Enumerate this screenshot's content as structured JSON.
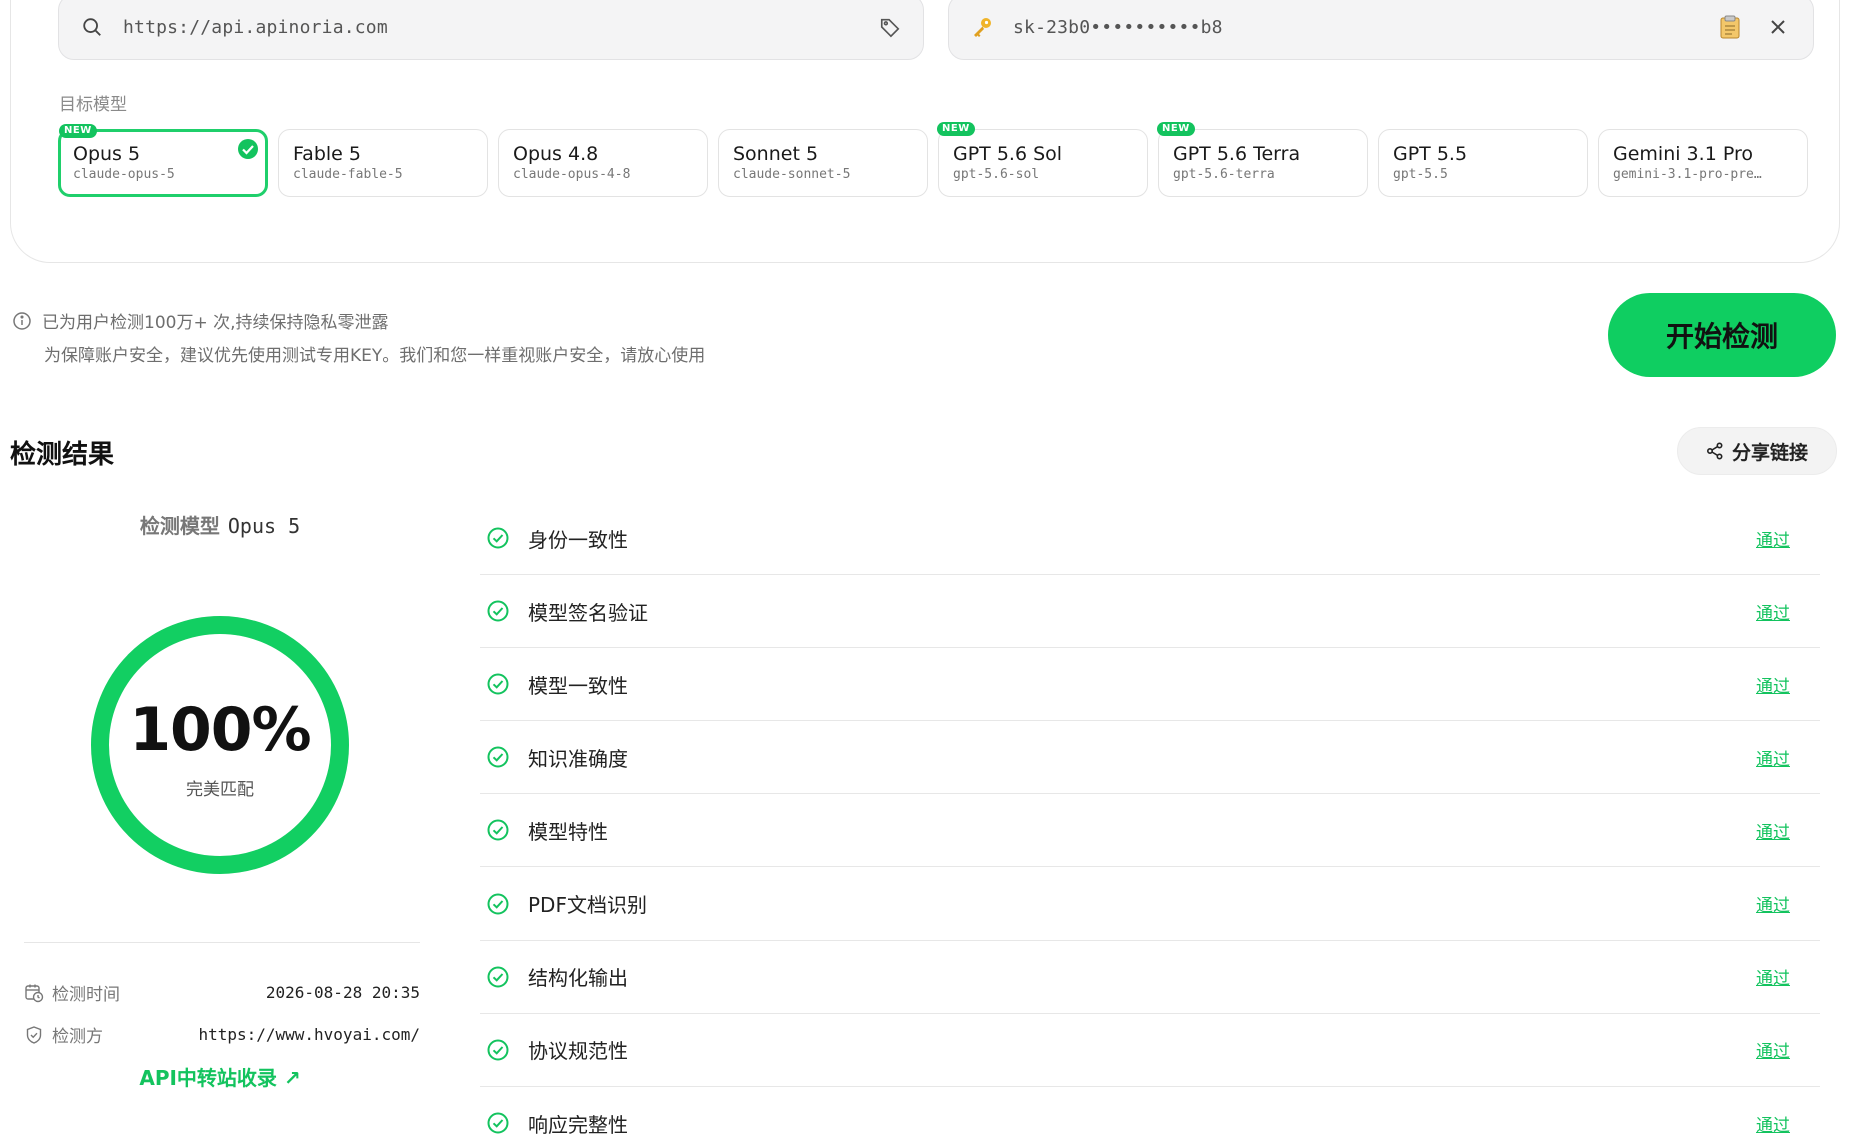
{
  "inputs": {
    "url_value": "https://api.apinoria.com",
    "key_value": "sk-23b0••••••••••b8"
  },
  "target_model_label": "目标模型",
  "models": [
    {
      "name": "Opus 5",
      "id": "claude-opus-5",
      "badge": "NEW",
      "selected": true
    },
    {
      "name": "Fable 5",
      "id": "claude-fable-5",
      "badge": "",
      "selected": false
    },
    {
      "name": "Opus 4.8",
      "id": "claude-opus-4-8",
      "badge": "",
      "selected": false
    },
    {
      "name": "Sonnet 5",
      "id": "claude-sonnet-5",
      "badge": "",
      "selected": false
    },
    {
      "name": "GPT 5.6 Sol",
      "id": "gpt-5.6-sol",
      "badge": "NEW",
      "selected": false
    },
    {
      "name": "GPT 5.6 Terra",
      "id": "gpt-5.6-terra",
      "badge": "NEW",
      "selected": false
    },
    {
      "name": "GPT 5.5",
      "id": "gpt-5.5",
      "badge": "",
      "selected": false
    },
    {
      "name": "Gemini 3.1 Pro",
      "id": "gemini-3.1-pro-pre…",
      "badge": "",
      "selected": false
    }
  ],
  "notice": {
    "line1": "已为用户检测100万+ 次,持续保持隐私零泄露",
    "line2": "为保障账户安全，建议优先使用测试专用KEY。我们和您一样重视账户安全，请放心使用"
  },
  "start_button": "开始检测",
  "results": {
    "title": "检测结果",
    "share_label": "分享链接",
    "detect_model_label": "检测模型",
    "detect_model_name": "Opus 5",
    "score_percent": 100,
    "score_text": "100%",
    "score_sub": "完美匹配",
    "time_label": "检测时间",
    "time_value": "2026-08-28 20:35",
    "detector_label": "检测方",
    "detector_value": "https://www.hvoyai.com/",
    "api_link": "API中转站收录 ↗",
    "checks": [
      {
        "name": "身份一致性",
        "status": "通过"
      },
      {
        "name": "模型签名验证",
        "status": "通过"
      },
      {
        "name": "模型一致性",
        "status": "通过"
      },
      {
        "name": "知识准确度",
        "status": "通过"
      },
      {
        "name": "模型特性",
        "status": "通过"
      },
      {
        "name": "PDF文档识别",
        "status": "通过"
      },
      {
        "name": "结构化输出",
        "status": "通过"
      },
      {
        "name": "协议规范性",
        "status": "通过"
      },
      {
        "name": "响应完整性",
        "status": "通过"
      }
    ]
  },
  "colors": {
    "accent": "#0fce61",
    "pass": "#13c35e"
  }
}
